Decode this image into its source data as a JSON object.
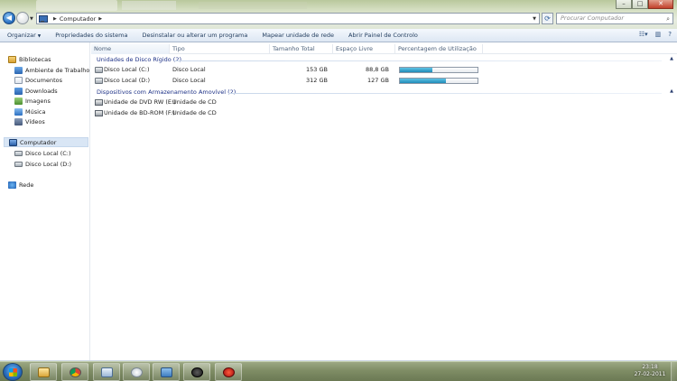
{
  "window": {
    "caption_buttons": {
      "minimize": "–",
      "maximize": "□",
      "close": "✕"
    }
  },
  "addressbar": {
    "location": "Computador",
    "search_placeholder": "Procurar Computador",
    "refresh_icon": "refresh-icon"
  },
  "commandbar": {
    "items": [
      "Organizar",
      "Propriedades do sistema",
      "Desinstalar ou alterar um programa",
      "Mapear unidade de rede",
      "Abrir Painel de Controlo"
    ]
  },
  "navpane": {
    "favorites_group": "Bibliotecas",
    "libraries": [
      "Ambiente de Trabalho",
      "Documentos",
      "Downloads",
      "Imagens",
      "Música",
      "Vídeos"
    ],
    "computer": "Computador",
    "drives": [
      "Disco Local (C:)",
      "Disco Local (D:)"
    ],
    "network": "Rede"
  },
  "columns": {
    "name": "Nome",
    "type": "Tipo",
    "total": "Tamanho Total",
    "free": "Espaço Livre",
    "usage": "Percentagem de Utilização"
  },
  "groups": [
    {
      "title": "Unidades de Disco Rígido (2)",
      "rows": [
        {
          "name": "Disco Local (C:)",
          "type": "Disco Local",
          "total": "153 GB",
          "free": "88,8 GB",
          "usage": 0.42
        },
        {
          "name": "Disco Local (D:)",
          "type": "Disco Local",
          "total": "312 GB",
          "free": "127 GB",
          "usage": 0.59
        }
      ]
    },
    {
      "title": "Dispositivos com Armazenamento Amovível (2)",
      "rows": [
        {
          "name": "Unidade de DVD RW (E:)",
          "type": "Unidade de CD"
        },
        {
          "name": "Unidade de BD-ROM (F:)",
          "type": "Unidade de CD"
        }
      ]
    }
  ],
  "taskbar": {
    "time": "23:18",
    "date": "27-02-2011"
  },
  "colors": {
    "usage_fill": "#1f8ab7",
    "group_title": "#1e3287"
  }
}
